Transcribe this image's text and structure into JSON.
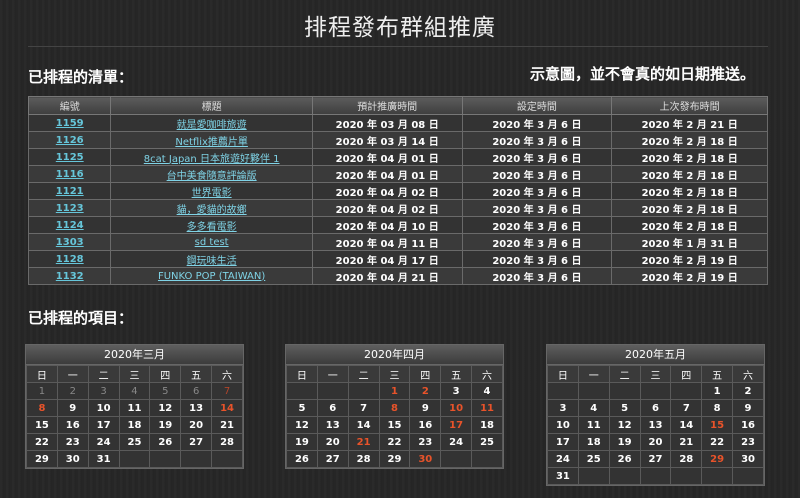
{
  "page": {
    "title": "排程發布群組推廣",
    "scheduled_list_heading": "已排程的清單：",
    "note": "示意圖，並不會真的如日期推送。",
    "scheduled_items_heading": "已排程的項目："
  },
  "table": {
    "headers": [
      "編號",
      "標題",
      "預計推廣時間",
      "設定時間",
      "上次發布時間"
    ],
    "rows": [
      [
        "1159",
        "就是愛咖啡旅遊",
        "2020 年 03 月 08 日",
        "2020 年 3 月 6 日",
        "2020 年 2 月 21 日"
      ],
      [
        "1126",
        "Netflix推薦片單",
        "2020 年 03 月 14 日",
        "2020 年 3 月 6 日",
        "2020 年 2 月 18 日"
      ],
      [
        "1125",
        "8cat Japan 日本旅遊好夥伴 1",
        "2020 年 04 月 01 日",
        "2020 年 3 月 6 日",
        "2020 年 2 月 18 日"
      ],
      [
        "1116",
        "台中美食隨意評論版",
        "2020 年 04 月 01 日",
        "2020 年 3 月 6 日",
        "2020 年 2 月 18 日"
      ],
      [
        "1121",
        "世界電影",
        "2020 年 04 月 02 日",
        "2020 年 3 月 6 日",
        "2020 年 2 月 18 日"
      ],
      [
        "1123",
        "貓，愛貓的故鄉",
        "2020 年 04 月 02 日",
        "2020 年 3 月 6 日",
        "2020 年 2 月 18 日"
      ],
      [
        "1124",
        "多多看電影",
        "2020 年 04 月 10 日",
        "2020 年 3 月 6 日",
        "2020 年 2 月 18 日"
      ],
      [
        "1303",
        "sd test",
        "2020 年 04 月 11 日",
        "2020 年 3 月 6 日",
        "2020 年 1 月 31 日"
      ],
      [
        "1128",
        "鋼玩味生活",
        "2020 年 04 月 17 日",
        "2020 年 3 月 6 日",
        "2020 年 2 月 19 日"
      ],
      [
        "1132",
        "FUNKO POP (TAIWAN)",
        "2020 年 04 月 21 日",
        "2020 年 3 月 6 日",
        "2020 年 2 月 19 日"
      ]
    ]
  },
  "weekdays": [
    "日",
    "一",
    "二",
    "三",
    "四",
    "五",
    "六"
  ],
  "calendars": [
    {
      "month": "2020年三月",
      "weeks": [
        [
          [
            "1",
            "past"
          ],
          [
            "2",
            "past"
          ],
          [
            "3",
            "past"
          ],
          [
            "4",
            "past"
          ],
          [
            "5",
            "past"
          ],
          [
            "6",
            "past"
          ],
          [
            "7",
            "pastred"
          ]
        ],
        [
          [
            "8",
            "red"
          ],
          [
            "9",
            ""
          ],
          [
            "10",
            ""
          ],
          [
            "11",
            ""
          ],
          [
            "12",
            ""
          ],
          [
            "13",
            ""
          ],
          [
            "14",
            "red"
          ]
        ],
        [
          [
            "15",
            ""
          ],
          [
            "16",
            ""
          ],
          [
            "17",
            ""
          ],
          [
            "18",
            ""
          ],
          [
            "19",
            ""
          ],
          [
            "20",
            ""
          ],
          [
            "21",
            ""
          ]
        ],
        [
          [
            "22",
            ""
          ],
          [
            "23",
            ""
          ],
          [
            "24",
            ""
          ],
          [
            "25",
            ""
          ],
          [
            "26",
            ""
          ],
          [
            "27",
            ""
          ],
          [
            "28",
            ""
          ]
        ],
        [
          [
            "29",
            ""
          ],
          [
            "30",
            ""
          ],
          [
            "31",
            ""
          ],
          [
            "",
            ""
          ],
          [
            "",
            ""
          ],
          [
            "",
            ""
          ],
          [
            "",
            ""
          ]
        ]
      ]
    },
    {
      "month": "2020年四月",
      "weeks": [
        [
          [
            "",
            ""
          ],
          [
            "",
            ""
          ],
          [
            "",
            ""
          ],
          [
            "1",
            "red"
          ],
          [
            "2",
            "red"
          ],
          [
            "3",
            ""
          ],
          [
            "4",
            ""
          ]
        ],
        [
          [
            "5",
            ""
          ],
          [
            "6",
            ""
          ],
          [
            "7",
            ""
          ],
          [
            "8",
            "red"
          ],
          [
            "9",
            ""
          ],
          [
            "10",
            "red"
          ],
          [
            "11",
            "red"
          ]
        ],
        [
          [
            "12",
            ""
          ],
          [
            "13",
            ""
          ],
          [
            "14",
            ""
          ],
          [
            "15",
            ""
          ],
          [
            "16",
            ""
          ],
          [
            "17",
            "red"
          ],
          [
            "18",
            ""
          ]
        ],
        [
          [
            "19",
            ""
          ],
          [
            "20",
            ""
          ],
          [
            "21",
            "red"
          ],
          [
            "22",
            ""
          ],
          [
            "23",
            ""
          ],
          [
            "24",
            ""
          ],
          [
            "25",
            ""
          ]
        ],
        [
          [
            "26",
            ""
          ],
          [
            "27",
            ""
          ],
          [
            "28",
            ""
          ],
          [
            "29",
            ""
          ],
          [
            "30",
            "red"
          ],
          [
            "",
            ""
          ],
          [
            "",
            ""
          ]
        ]
      ]
    },
    {
      "month": "2020年五月",
      "weeks": [
        [
          [
            "",
            ""
          ],
          [
            "",
            ""
          ],
          [
            "",
            ""
          ],
          [
            "",
            ""
          ],
          [
            "",
            ""
          ],
          [
            "1",
            ""
          ],
          [
            "2",
            ""
          ]
        ],
        [
          [
            "3",
            ""
          ],
          [
            "4",
            ""
          ],
          [
            "5",
            ""
          ],
          [
            "6",
            ""
          ],
          [
            "7",
            ""
          ],
          [
            "8",
            ""
          ],
          [
            "9",
            ""
          ]
        ],
        [
          [
            "10",
            ""
          ],
          [
            "11",
            ""
          ],
          [
            "12",
            ""
          ],
          [
            "13",
            ""
          ],
          [
            "14",
            ""
          ],
          [
            "15",
            "red"
          ],
          [
            "16",
            ""
          ]
        ],
        [
          [
            "17",
            ""
          ],
          [
            "18",
            ""
          ],
          [
            "19",
            ""
          ],
          [
            "20",
            ""
          ],
          [
            "21",
            ""
          ],
          [
            "22",
            ""
          ],
          [
            "23",
            ""
          ]
        ],
        [
          [
            "24",
            ""
          ],
          [
            "25",
            ""
          ],
          [
            "26",
            ""
          ],
          [
            "27",
            ""
          ],
          [
            "28",
            ""
          ],
          [
            "29",
            "red"
          ],
          [
            "30",
            ""
          ]
        ],
        [
          [
            "31",
            ""
          ],
          [
            "",
            ""
          ],
          [
            "",
            ""
          ],
          [
            "",
            ""
          ],
          [
            "",
            ""
          ],
          [
            "",
            ""
          ],
          [
            "",
            ""
          ]
        ]
      ]
    }
  ],
  "colors": {
    "link": "#7fd3e6",
    "highlight": "#e8532a",
    "background": "#262626"
  }
}
